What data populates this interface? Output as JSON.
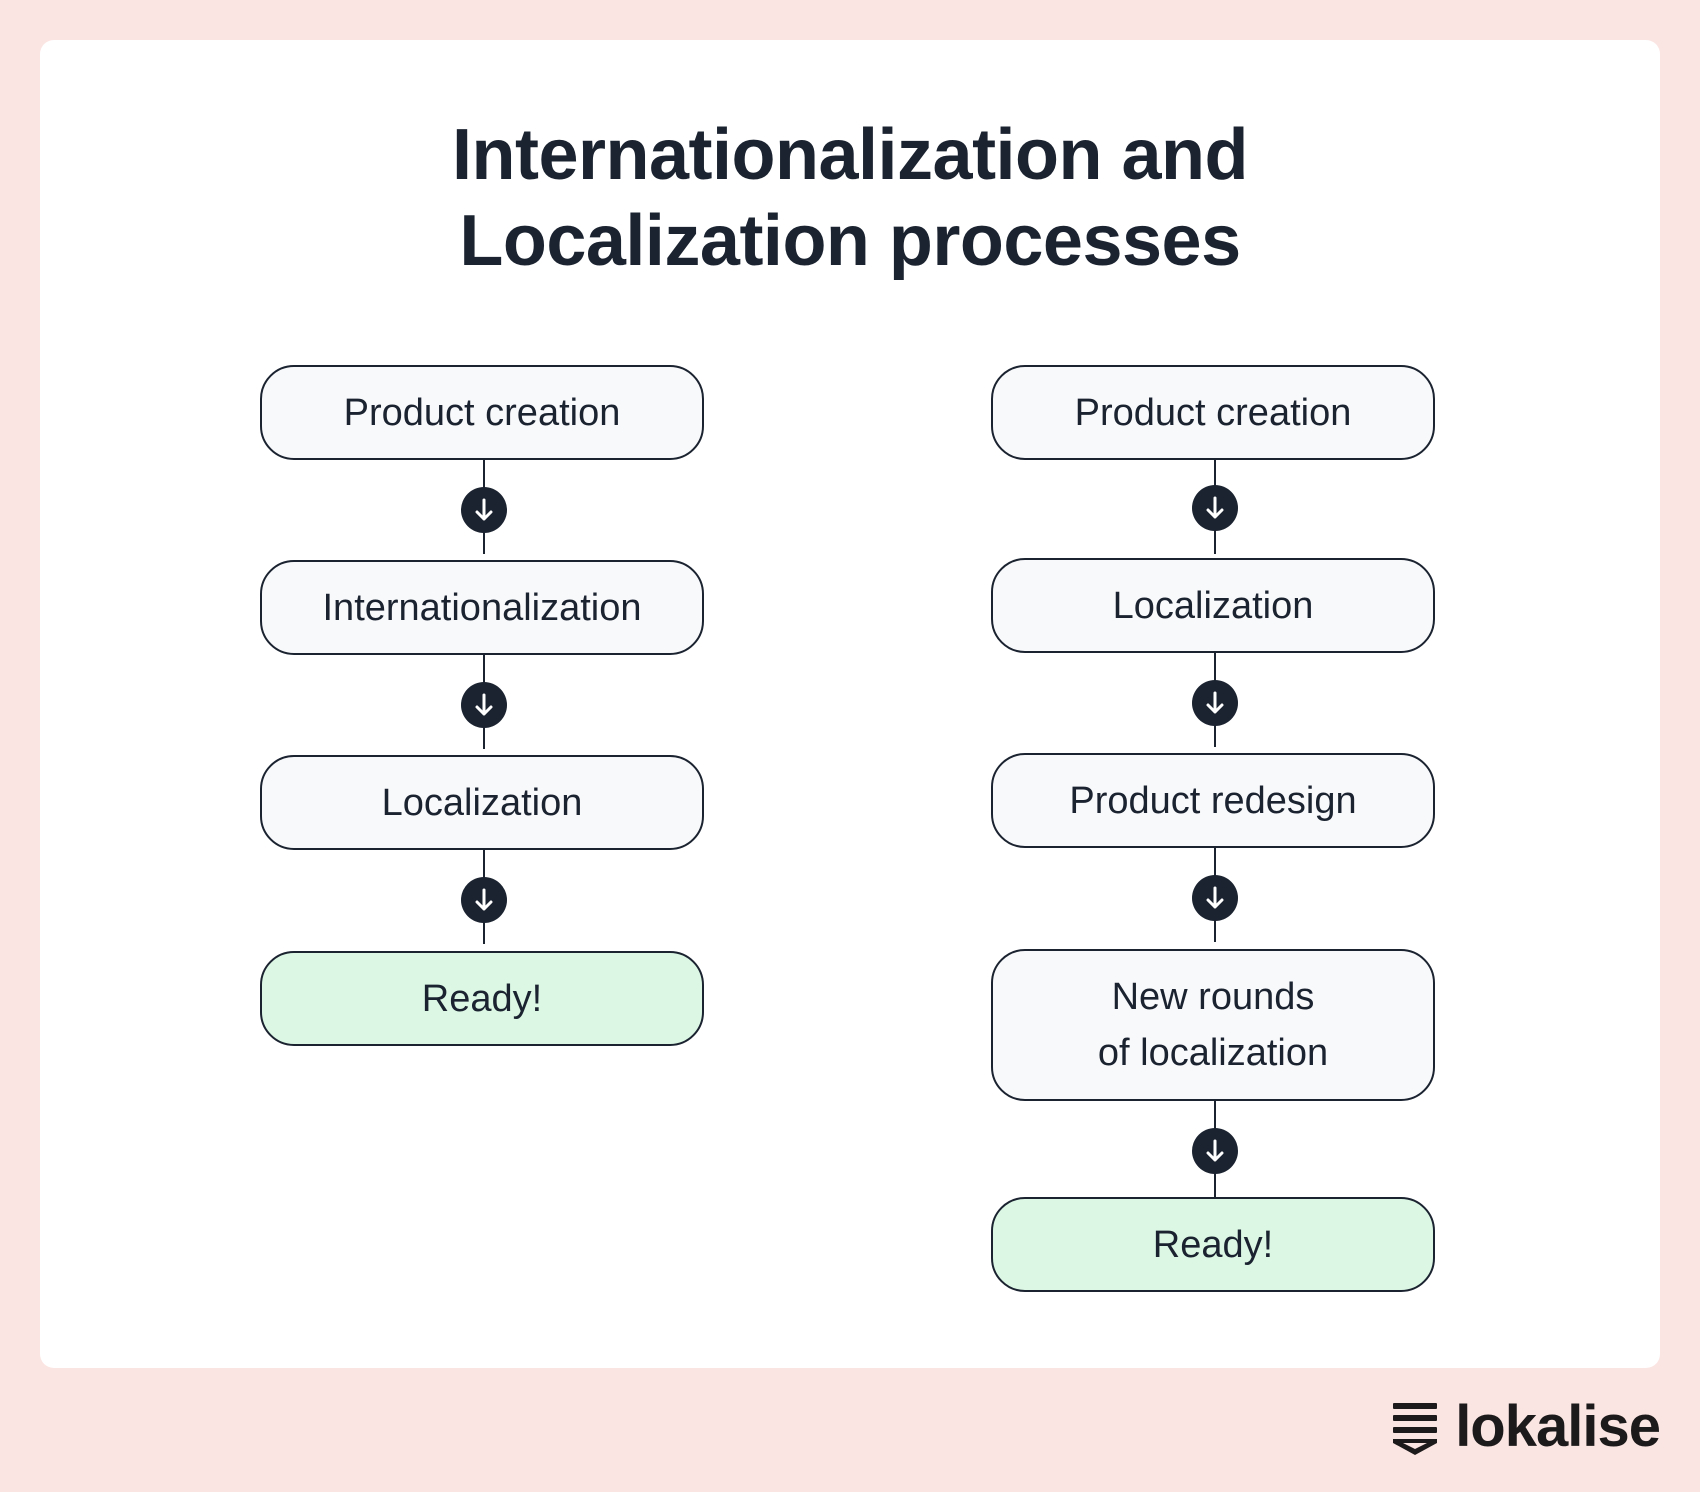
{
  "title": {
    "line1": "Internationalization and",
    "line2": "Localization processes"
  },
  "colors": {
    "page_background": "#fbe5e3",
    "card_background": "#ffffff",
    "node_fill": "#f8f9fb",
    "ready_fill": "#dcf8e5",
    "ink": "#1b2330"
  },
  "flows": [
    {
      "steps": [
        {
          "label": "Product creation",
          "kind": "step"
        },
        {
          "label": "Internationalization",
          "kind": "step"
        },
        {
          "label": "Localization",
          "kind": "step"
        },
        {
          "label": "Ready!",
          "kind": "final"
        }
      ]
    },
    {
      "steps": [
        {
          "label": "Product creation",
          "kind": "step"
        },
        {
          "label": "Localization",
          "kind": "step"
        },
        {
          "label": "Product redesign",
          "kind": "step"
        },
        {
          "label": "New rounds\nof localization",
          "kind": "step"
        },
        {
          "label": "Ready!",
          "kind": "final"
        }
      ]
    }
  ],
  "connector_icon": "arrow-down-icon",
  "brand": {
    "name": "lokalise",
    "icon": "lokalise-logo-icon"
  }
}
